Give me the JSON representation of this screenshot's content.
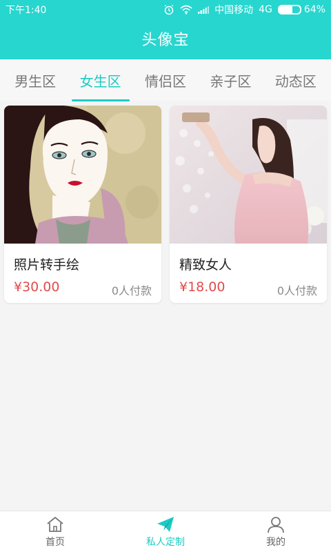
{
  "status": {
    "time": "下午1:40",
    "carrier": "中国移动",
    "network": "4G",
    "battery_text": "64%",
    "battery_level": 0.64,
    "icons": [
      "alarm-icon",
      "wifi-icon",
      "signal-icon",
      "battery-icon"
    ]
  },
  "header": {
    "title": "头像宝"
  },
  "tabs": [
    {
      "label": "男生区",
      "active": false
    },
    {
      "label": "女生区",
      "active": true
    },
    {
      "label": "情侣区",
      "active": false
    },
    {
      "label": "亲子区",
      "active": false
    },
    {
      "label": "动态区",
      "active": false
    }
  ],
  "cards": [
    {
      "name": "照片转手绘",
      "price": "¥30.00",
      "paid": "0人付款"
    },
    {
      "name": "精致女人",
      "price": "¥18.00",
      "paid": "0人付款"
    }
  ],
  "bottom_nav": [
    {
      "label": "首页",
      "icon": "home-icon",
      "active": false
    },
    {
      "label": "私人定制",
      "icon": "paper-plane-icon",
      "active": true
    },
    {
      "label": "我的",
      "icon": "user-icon",
      "active": false
    }
  ],
  "colors": {
    "accent": "#27d6cf",
    "tab_active": "#1ccbc4",
    "price": "#e24b4b"
  }
}
